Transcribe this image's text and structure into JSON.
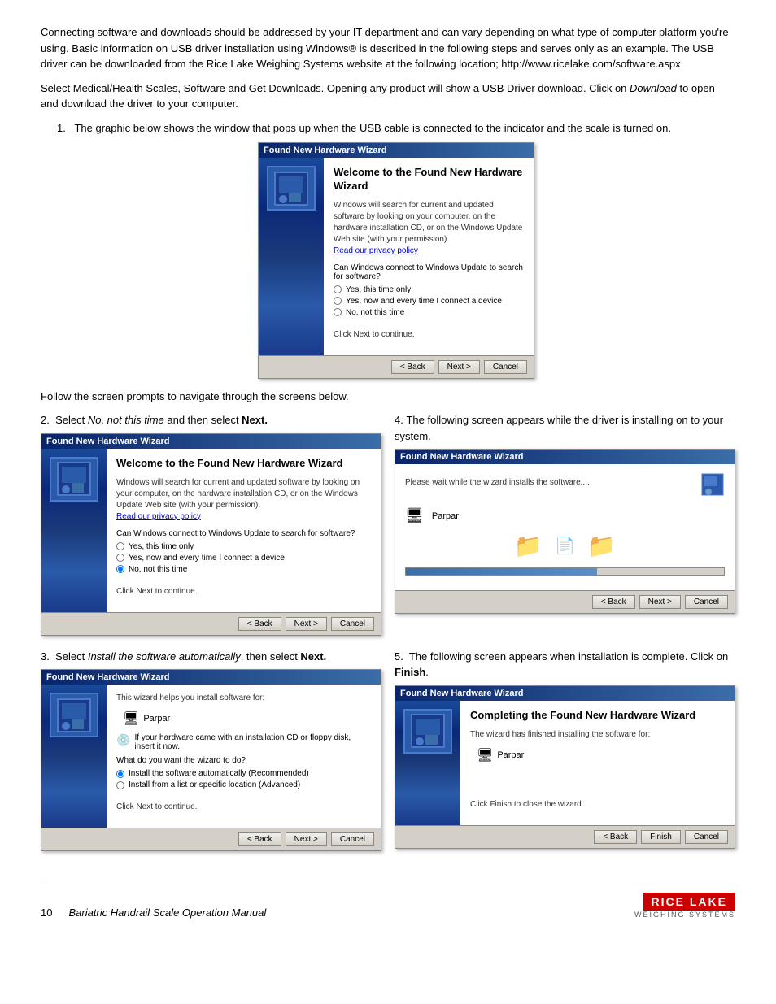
{
  "intro": {
    "para1": "Connecting software and downloads should be addressed by your IT department and can vary depending on what type of computer platform you're using. Basic information on USB driver installation using Windows® is described in the following steps and serves only as an example. The USB driver can be downloaded from the Rice Lake Weighing Systems website at the following location; http://www.ricelake.com/software.aspx",
    "para2": "Select Medical/Health Scales, Software and Get Downloads. Opening any product will show a USB Driver download. Click on Download to open and download the driver to your computer."
  },
  "step1": {
    "number": "1.",
    "text": "The graphic below shows the window that pops up when the USB cable is connected to the indicator and the scale is turned on."
  },
  "follow_text": "Follow the screen prompts to navigate through the screens below.",
  "step2": {
    "number": "2.",
    "label_before": "Select ",
    "label_italic": "No, not this time",
    "label_after": " and then select ",
    "label_bold": "Next."
  },
  "step3": {
    "number": "3.",
    "label_before": "Select ",
    "label_italic": "Install the software automatically",
    "label_after": ", then select ",
    "label_bold": "Next."
  },
  "step4": {
    "number": "4.",
    "text": "The following screen appears while the driver is installing on to your system."
  },
  "step5": {
    "number": "5.",
    "label_before": "The following screen appears when installation is complete. Click on ",
    "label_bold": "Finish",
    "label_after": "."
  },
  "dialogs": {
    "titlebar": "Found New Hardware Wizard",
    "welcome_title": "Welcome to the Found New Hardware Wizard",
    "desc1": "Windows will search for current and updated software by looking on your computer, on the hardware installation CD, or on the Windows Update Web site (with your permission).",
    "privacy_link": "Read our privacy policy",
    "question": "Can Windows connect to Windows Update to search for software?",
    "radio1": "Yes, this time only",
    "radio2": "Yes, now and every time I connect a device",
    "radio3": "No, not this time",
    "click_next": "Click Next to continue.",
    "back_btn": "< Back",
    "next_btn": "Next >",
    "cancel_btn": "Cancel",
    "install_title": "This wizard helps you install software for:",
    "device_name": "Parpar",
    "cd_text": "If your hardware came with an installation CD or floppy disk, insert it now.",
    "what_do": "What do you want the wizard to do?",
    "radio_auto": "Install the software automatically (Recommended)",
    "radio_list": "Install from a list or specific location (Advanced)",
    "installing_msg": "Please wait while the wizard installs the software....",
    "completing_title": "Completing the Found New Hardware Wizard",
    "completing_desc": "The wizard has finished installing the software for:",
    "click_finish": "Click Finish to close the wizard.",
    "finish_btn": "Finish"
  },
  "footer": {
    "page_number": "10",
    "manual_title": "Bariatric Handrail Scale Operation Manual",
    "brand_name": "RICE LAKE",
    "brand_sub": "WEIGHING SYSTEMS"
  }
}
